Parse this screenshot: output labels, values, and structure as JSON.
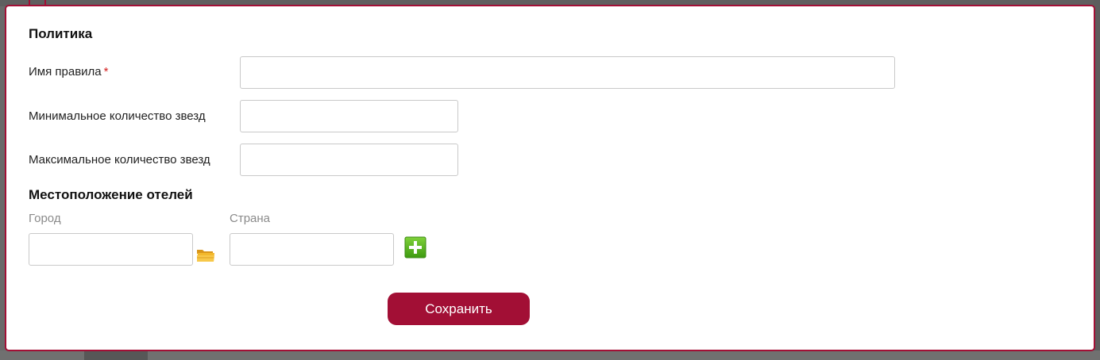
{
  "modal": {
    "policy_title": "Политика",
    "fields": {
      "rule_name": {
        "label": "Имя правила",
        "required_mark": "*",
        "value": ""
      },
      "min_stars": {
        "label": "Минимальное количество звезд",
        "value": ""
      },
      "max_stars": {
        "label": "Максимальное количество звезд",
        "value": ""
      }
    },
    "location_title": "Местоположение отелей",
    "location": {
      "city": {
        "label": "Город",
        "value": ""
      },
      "country": {
        "label": "Страна",
        "value": ""
      }
    },
    "icons": {
      "folder": "folder-icon",
      "add": "plus-icon"
    },
    "save_label": "Сохранить"
  },
  "colors": {
    "accent": "#a20f35",
    "required": "#d42020",
    "add_green": "#4fae1a",
    "folder_yellow": "#f3b82c"
  }
}
